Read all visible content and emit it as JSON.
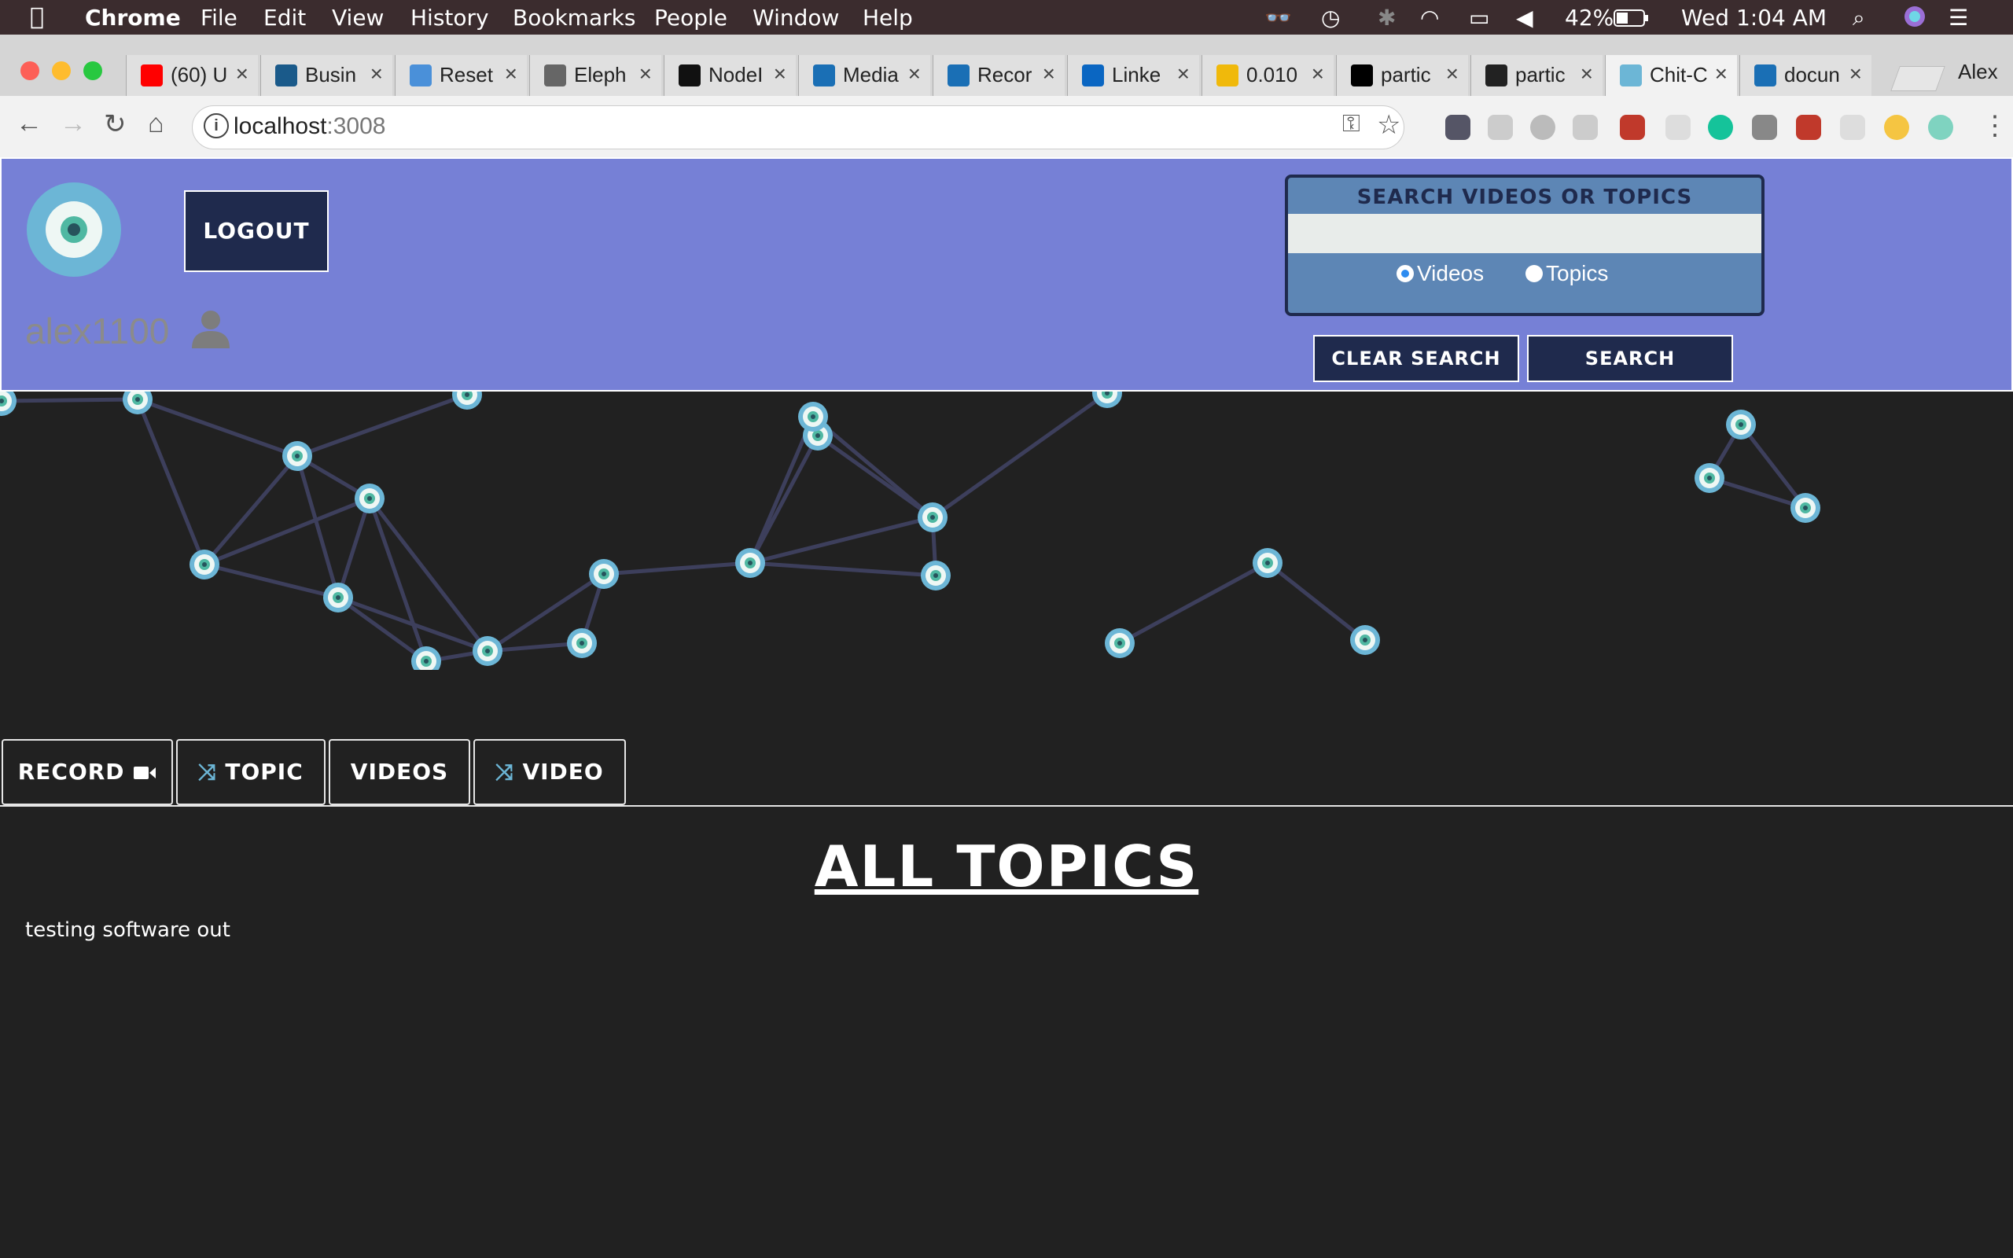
{
  "menubar": {
    "app": "Chrome",
    "items": [
      "File",
      "Edit",
      "View",
      "History",
      "Bookmarks",
      "People",
      "Window",
      "Help"
    ],
    "battery": "42%",
    "clock": "Wed 1:04 AM"
  },
  "tabs": [
    {
      "title": "(60) U",
      "icon": "youtube-icon",
      "color": "#ff0000"
    },
    {
      "title": "Busin",
      "icon": "bi-icon",
      "color": "#1a5a8a"
    },
    {
      "title": "Reset",
      "icon": "dots-icon",
      "color": "#4a90d9"
    },
    {
      "title": "Eleph",
      "icon": "elephant-icon",
      "color": "#666666"
    },
    {
      "title": "NodeI",
      "icon": "github-icon",
      "color": "#111111"
    },
    {
      "title": "Media",
      "icon": "panther-icon",
      "color": "#1a6fb5"
    },
    {
      "title": "Recor",
      "icon": "panther-icon",
      "color": "#1a6fb5"
    },
    {
      "title": "Linke",
      "icon": "linkedin-icon",
      "color": "#0a66c2"
    },
    {
      "title": "0.010",
      "icon": "binance-icon",
      "color": "#f0b90b"
    },
    {
      "title": "partic",
      "icon": "square-icon",
      "color": "#000000"
    },
    {
      "title": "partic",
      "icon": "codepen-icon",
      "color": "#222222"
    },
    {
      "title": "Chit-C",
      "icon": "eye-icon",
      "color": "#6cb6d6",
      "active": true
    },
    {
      "title": "docun",
      "icon": "panther-icon",
      "color": "#1a6fb5"
    }
  ],
  "profile": "Alex",
  "address": {
    "host": "localhost",
    "port": ":3008"
  },
  "header": {
    "logout": "LOGOUT",
    "username": "alex1100"
  },
  "search": {
    "title": "SEARCH VIDEOS OR TOPICS",
    "value": "",
    "options": [
      {
        "label": "Videos",
        "checked": true
      },
      {
        "label": "Topics",
        "checked": false
      }
    ],
    "clear": "CLEAR SEARCH",
    "submit": "SEARCH"
  },
  "actions": {
    "record": "RECORD",
    "topic": "TOPIC",
    "videos": "VIDEOS",
    "video": "VIDEO"
  },
  "main": {
    "title": "ALL TOPICS",
    "topics": [
      "testing software out"
    ]
  },
  "colors": {
    "header_bg": "#7680d6",
    "button_bg": "#1f2a4d",
    "page_bg": "#212121",
    "node": "#6cb6d6",
    "edge": "#3d3f5c"
  }
}
